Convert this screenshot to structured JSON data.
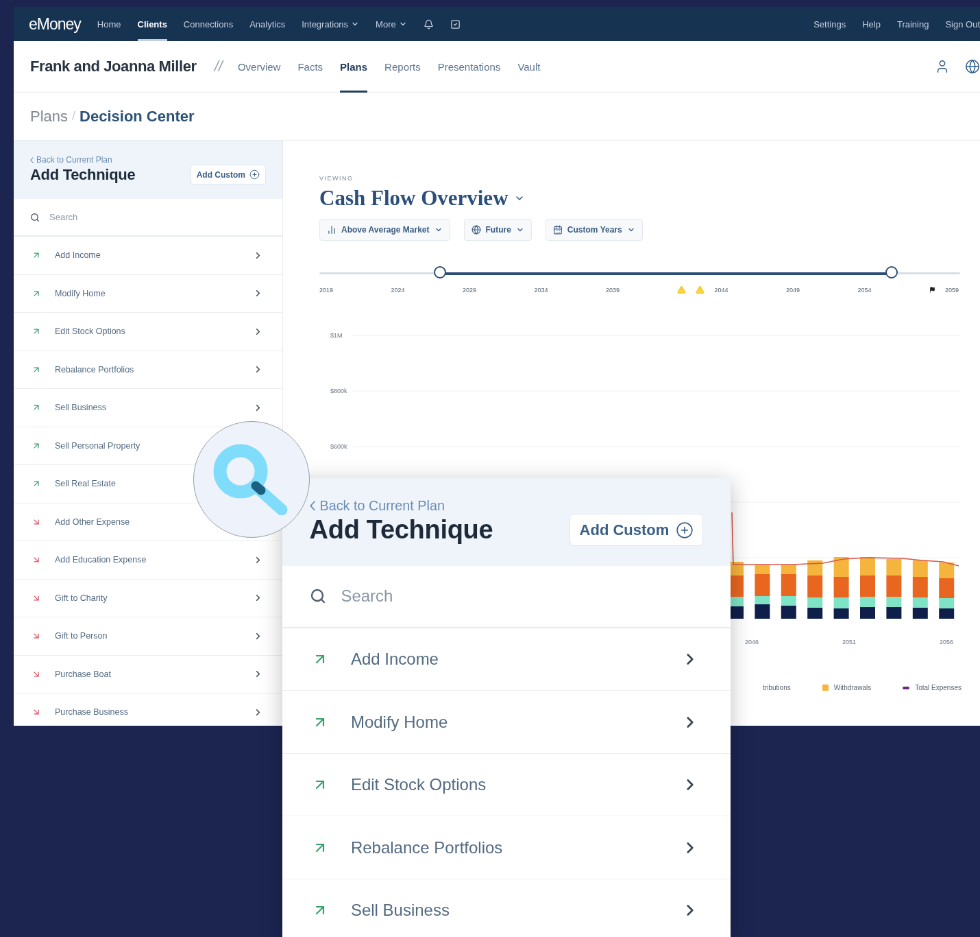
{
  "top_nav": {
    "logo": "eMoney",
    "items": [
      {
        "label": "Home",
        "selected": false,
        "dropdown": false
      },
      {
        "label": "Clients",
        "selected": true,
        "dropdown": false
      },
      {
        "label": "Connections",
        "selected": false,
        "dropdown": false
      },
      {
        "label": "Analytics",
        "selected": false,
        "dropdown": false
      },
      {
        "label": "Integrations",
        "selected": false,
        "dropdown": true
      },
      {
        "label": "More",
        "selected": false,
        "dropdown": true
      }
    ],
    "links": [
      "Settings",
      "Help",
      "Training",
      "Sign Out"
    ]
  },
  "client_bar": {
    "name": "Frank and Joanna Miller",
    "separator": "//",
    "tabs": [
      {
        "label": "Overview",
        "selected": false
      },
      {
        "label": "Facts",
        "selected": false
      },
      {
        "label": "Plans",
        "selected": true
      },
      {
        "label": "Reports",
        "selected": false
      },
      {
        "label": "Presentations",
        "selected": false
      },
      {
        "label": "Vault",
        "selected": false
      }
    ]
  },
  "breadcrumb": {
    "parent": "Plans",
    "separator": "/",
    "current": "Decision Center"
  },
  "technique_panel": {
    "back_link": "Back to Current Plan",
    "title": "Add Technique",
    "add_button": "Add Custom",
    "search": {
      "placeholder": "Search"
    },
    "items": [
      {
        "label": "Add Income",
        "kind": "income",
        "chevron": true
      },
      {
        "label": "Modify Home",
        "kind": "income",
        "chevron": true
      },
      {
        "label": "Edit Stock Options",
        "kind": "income",
        "chevron": true
      },
      {
        "label": "Rebalance Portfolios",
        "kind": "income",
        "chevron": true
      },
      {
        "label": "Sell Business",
        "kind": "income",
        "chevron": true
      },
      {
        "label": "Sell Personal Property",
        "kind": "income",
        "chevron": false
      },
      {
        "label": "Sell Real Estate",
        "kind": "income",
        "chevron": false
      },
      {
        "label": "Add Other Expense",
        "kind": "expense",
        "chevron": false
      },
      {
        "label": "Add Education Expense",
        "kind": "expense",
        "chevron": true
      },
      {
        "label": "Gift to Charity",
        "kind": "expense",
        "chevron": true
      },
      {
        "label": "Gift to Person",
        "kind": "expense",
        "chevron": true
      },
      {
        "label": "Purchase Boat",
        "kind": "expense",
        "chevron": true
      },
      {
        "label": "Purchase Business",
        "kind": "expense",
        "chevron": true
      }
    ]
  },
  "main": {
    "eyebrow": "VIEWING",
    "title": "Cash Flow Overview",
    "filters": [
      {
        "kind": "market",
        "label": "Above Average Market"
      },
      {
        "kind": "future",
        "label": "Future"
      },
      {
        "kind": "years",
        "label": "Custom Years"
      }
    ],
    "timeline": {
      "start": {
        "level": 0.188
      },
      "end": {
        "level": 0.893
      },
      "labels": [
        {
          "text": "2019",
          "alert": false,
          "milestone": false
        },
        {
          "text": "2024",
          "alert": false,
          "milestone": false
        },
        {
          "text": "2029",
          "alert": false,
          "milestone": false
        },
        {
          "text": "2034",
          "alert": false,
          "milestone": false
        },
        {
          "text": "2039",
          "alert": false,
          "milestone": false
        },
        {
          "text": "2044",
          "alert": true,
          "milestone": false
        },
        {
          "text": "2049",
          "alert": false,
          "milestone": false
        },
        {
          "text": "2054",
          "alert": false,
          "milestone": false
        },
        {
          "text": "2059",
          "alert": false,
          "milestone": true
        }
      ]
    },
    "chart": {
      "y_labels": [
        "$1M",
        "$800k",
        "$600k"
      ],
      "x_labels": [
        "2046",
        "2051",
        "2056"
      ],
      "legend": [
        {
          "label": "tributions"
        },
        {
          "label": "Withdrawals",
          "color": "#f5b43c"
        },
        {
          "label": "Total Expenses",
          "color": "#6a2877"
        }
      ]
    }
  },
  "zoom_panel": {
    "back_link": "Back to Current Plan",
    "title": "Add Technique",
    "add_button": "Add Custom",
    "search": {
      "placeholder": "Search"
    },
    "items": [
      {
        "label": "Add Income",
        "kind": "income",
        "chevron": true
      },
      {
        "label": "Modify Home",
        "kind": "income",
        "chevron": true
      },
      {
        "label": "Edit Stock Options",
        "kind": "income",
        "chevron": true
      },
      {
        "label": "Rebalance Portfolios",
        "kind": "income",
        "chevron": true
      },
      {
        "label": "Sell Business",
        "kind": "income",
        "chevron": true
      }
    ]
  }
}
